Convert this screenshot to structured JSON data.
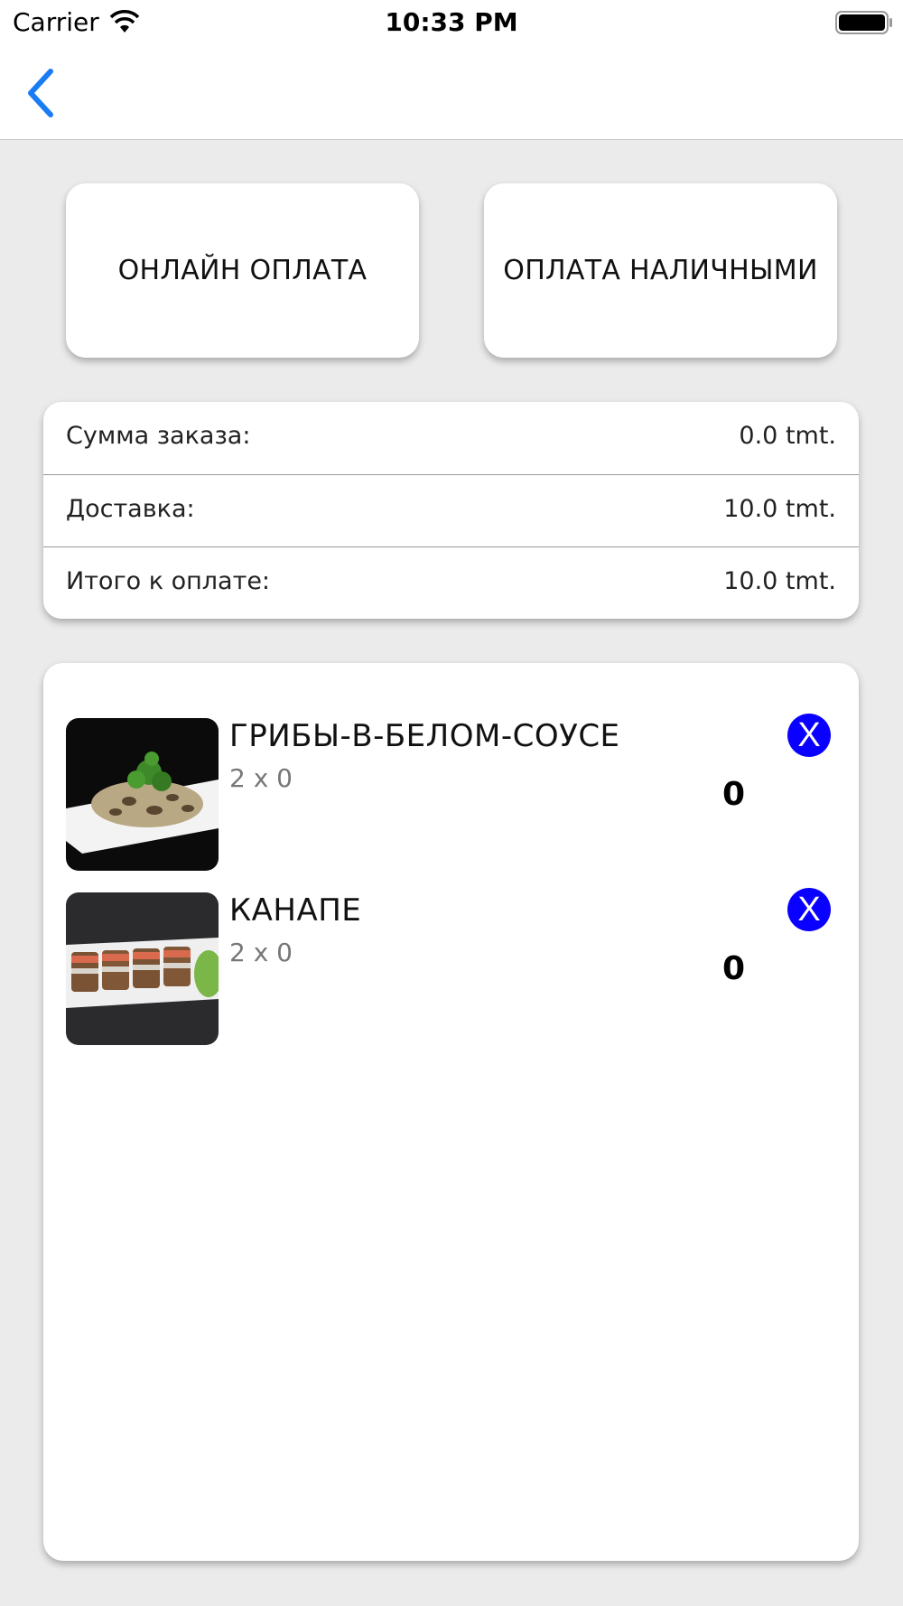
{
  "status_bar": {
    "carrier": "Carrier",
    "time": "10:33 PM"
  },
  "nav": {
    "back_icon": "chevron-left-icon",
    "accent": "#1a7cf5"
  },
  "payment": {
    "online_label": "ОНЛАЙН ОПЛАТА",
    "cash_label": "ОПЛАТА НАЛИЧНЫМИ"
  },
  "summary": {
    "rows": [
      {
        "label": "Сумма заказа:",
        "value": "0.0 tmt."
      },
      {
        "label": "Доставка:",
        "value": "10.0 tmt."
      },
      {
        "label": "Итого к оплате:",
        "value": "10.0 tmt."
      }
    ]
  },
  "cart": {
    "items": [
      {
        "name": "ГРИБЫ-В-БЕЛОМ-СОУСЕ",
        "qty_price": "2 x 0",
        "total": "0",
        "remove_label": "X"
      },
      {
        "name": "КАНАПЕ",
        "qty_price": "2 x 0",
        "total": "0",
        "remove_label": "X"
      }
    ],
    "remove_color": "#0a00ff"
  }
}
